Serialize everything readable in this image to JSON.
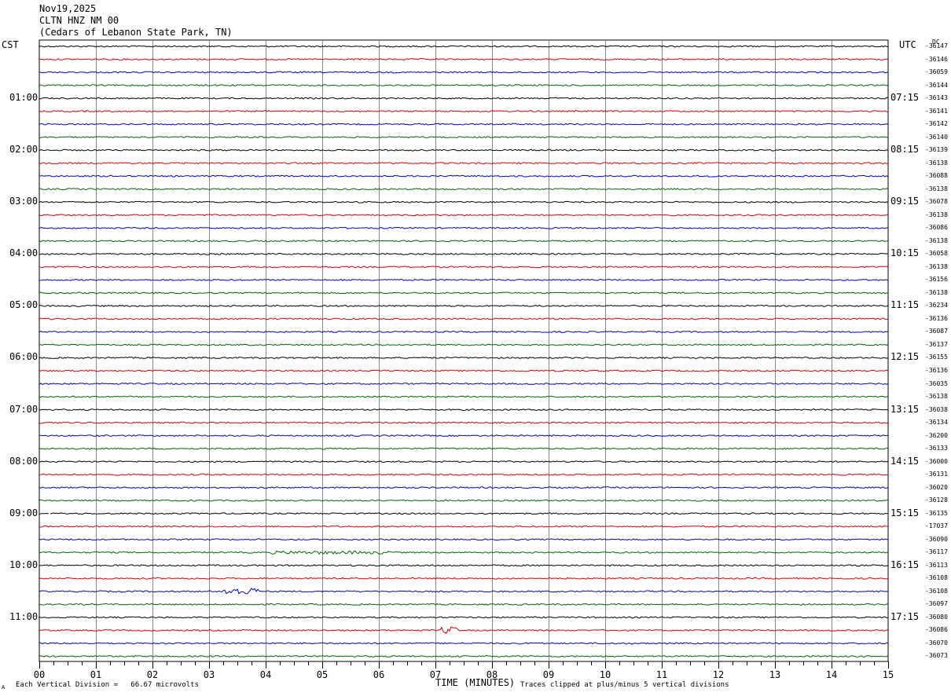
{
  "header": {
    "date": "Nov19,2025",
    "station": "CLTN HNZ NM 00",
    "location": "(Cedars of Lebanon State Park, TN)"
  },
  "labels": {
    "left_zone": "CST",
    "right_zone": "UTC",
    "dc": "DC"
  },
  "footer": {
    "division": "Each Vertical Division =   66.67 microvolts",
    "clip": "Traces clipped at plus/minus 5 vertical divisions",
    "mark": "A"
  },
  "colors": [
    "#000000",
    "#dd0000",
    "#0000cc",
    "#006600"
  ],
  "chart_data": {
    "type": "line",
    "xlabel": "TIME (MINUTES)",
    "xlim": [
      0,
      15
    ],
    "x_ticks": [
      "00",
      "01",
      "02",
      "03",
      "04",
      "05",
      "06",
      "07",
      "08",
      "09",
      "10",
      "11",
      "12",
      "13",
      "14",
      "15"
    ],
    "rows_per_hour": 4,
    "left_time_labels": [
      "01:00",
      "02:00",
      "03:00",
      "04:00",
      "05:00",
      "06:00",
      "07:00",
      "08:00",
      "09:00",
      "10:00",
      "11:00"
    ],
    "right_time_labels": [
      "07:15",
      "08:15",
      "09:15",
      "10:15",
      "11:15",
      "12:15",
      "13:15",
      "14:15",
      "15:15",
      "16:15",
      "17:15"
    ],
    "dc_offsets": [
      "-36147",
      "-36146",
      "-36059",
      "-36144",
      "-36143",
      "-36141",
      "-36142",
      "-36140",
      "-36139",
      "-36138",
      "-36088",
      "-36138",
      "-36078",
      "-36138",
      "-36086",
      "-36138",
      "-36058",
      "-36138",
      "-36156",
      "-36138",
      "-36234",
      "-36136",
      "-36087",
      "-36137",
      "-36155",
      "-36136",
      "-36035",
      "-36138",
      "-36038",
      "-36134",
      "-36200",
      "-36133",
      "-36000",
      "-36131",
      "-36020",
      "-36128",
      "-36135",
      "-17037",
      "-36090",
      "-36117",
      "-36113",
      "-36108",
      "-36108",
      "-36097",
      "-36080",
      "-36086",
      "-36070",
      "-36073"
    ],
    "events": [
      {
        "row": 36,
        "x_start": 0.05,
        "x_end": 0.17,
        "label": "gap"
      },
      {
        "row": 39,
        "x_start": 4.1,
        "x_end": 6.2,
        "label": "noise"
      },
      {
        "row": 42,
        "x_start": 3.2,
        "x_end": 3.9,
        "label": "burst"
      },
      {
        "row": 45,
        "x_start": 7.1,
        "x_end": 7.4,
        "label": "burst"
      }
    ]
  }
}
